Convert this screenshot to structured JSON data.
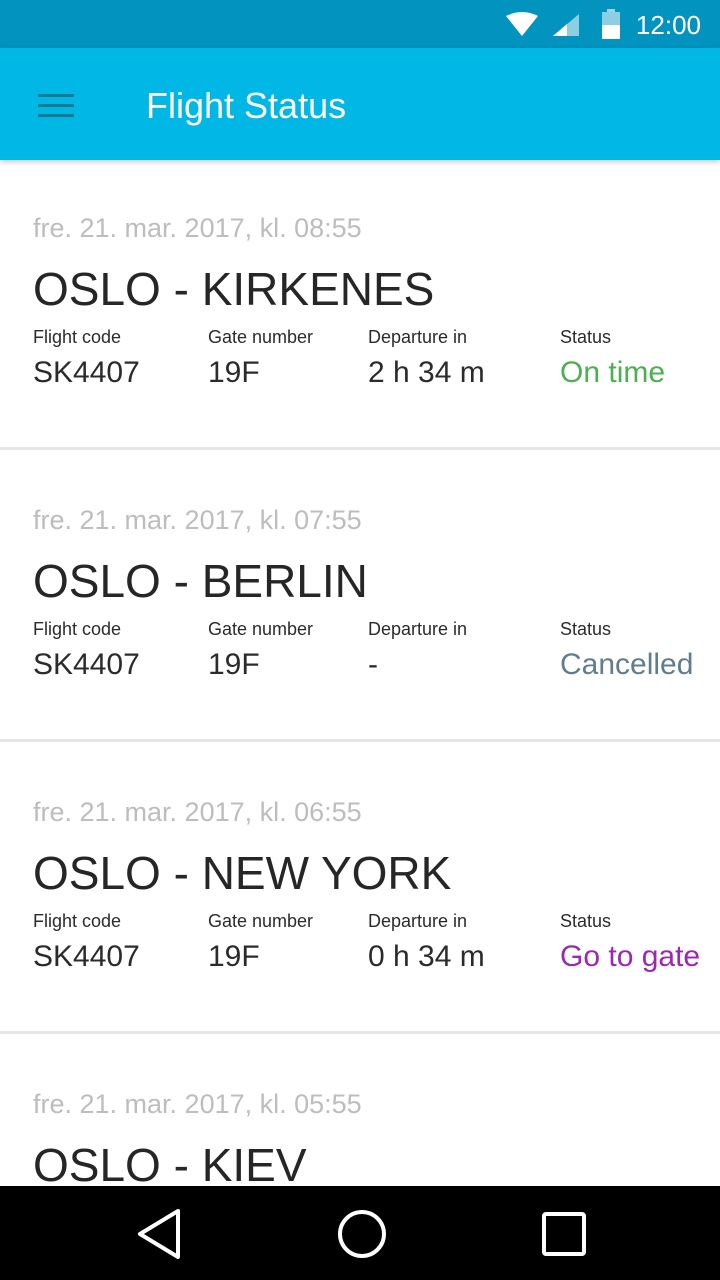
{
  "status_bar": {
    "time": "12:00"
  },
  "app_bar": {
    "title": "Flight Status",
    "menu_icon": "menu-icon"
  },
  "labels": {
    "flight_code": "Flight code",
    "gate_number": "Gate number",
    "departure_in": "Departure in",
    "status": "Status"
  },
  "colors": {
    "status_bar": "#0393bf",
    "app_bar": "#00b7e5",
    "on_time": "#4caf50",
    "cancelled": "#607d8b",
    "go_to_gate": "#9c27b0"
  },
  "flights": [
    {
      "date": "fre. 21. mar. 2017, kl. 08:55",
      "route": "OSLO - KIRKENES",
      "flight_code": "SK4407",
      "gate": "19F",
      "departure_in": "2 h 34 m",
      "status": "On time",
      "status_color": "#4caf50"
    },
    {
      "date": "fre. 21. mar. 2017, kl. 07:55",
      "route": "OSLO - BERLIN",
      "flight_code": "SK4407",
      "gate": "19F",
      "departure_in": "-",
      "status": "Cancelled",
      "status_color": "#607d8b"
    },
    {
      "date": "fre. 21. mar. 2017, kl. 06:55",
      "route": "OSLO - NEW YORK",
      "flight_code": "SK4407",
      "gate": "19F",
      "departure_in": "0 h 34 m",
      "status": "Go to gate",
      "status_color": "#9c27b0"
    },
    {
      "date": "fre. 21. mar. 2017, kl. 05:55",
      "route": "OSLO - KIEV",
      "flight_code": "",
      "gate": "",
      "departure_in": "",
      "status": "",
      "status_color": "#4caf50"
    }
  ],
  "nav_bar": {
    "back_icon": "back-icon",
    "home_icon": "home-icon",
    "recents_icon": "recents-icon"
  }
}
